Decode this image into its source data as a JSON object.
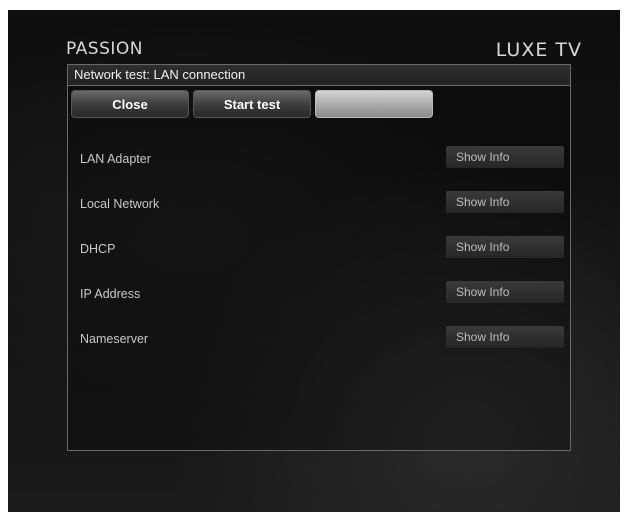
{
  "brand": {
    "left": "PASSION",
    "right": "LUXE TV"
  },
  "panel": {
    "title": "Network test: LAN connection"
  },
  "buttons": {
    "close": "Close",
    "start": "Start test",
    "third": ""
  },
  "rows": [
    {
      "label": "LAN Adapter",
      "action": "Show Info"
    },
    {
      "label": "Local Network",
      "action": "Show Info"
    },
    {
      "label": "DHCP",
      "action": "Show Info"
    },
    {
      "label": "IP Address",
      "action": "Show Info"
    },
    {
      "label": "Nameserver",
      "action": "Show Info"
    }
  ]
}
